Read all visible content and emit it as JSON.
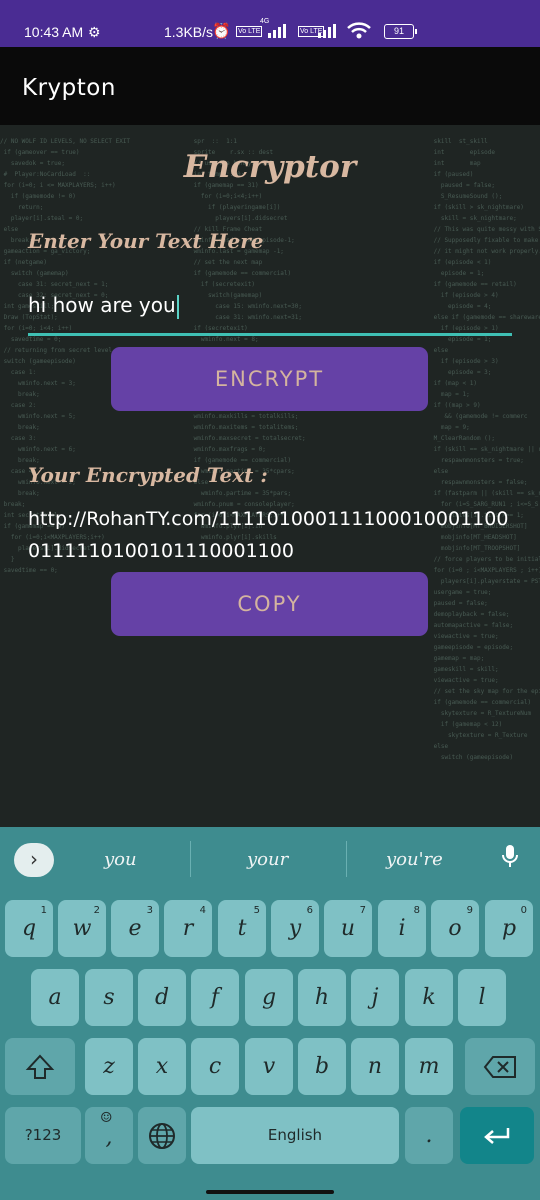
{
  "status_bar": {
    "time": "10:43 AM",
    "speed": "1.3KB/s",
    "battery": "91",
    "volte1": "Vo LTE",
    "volte2": "Vo LTE",
    "net": "4G"
  },
  "app_bar": {
    "title": "Krypton"
  },
  "main": {
    "heading": "Encryptor",
    "input_label": "Enter Your Text Here",
    "input_value": "hi how are you",
    "encrypt_button": "ENCRYPT",
    "result_label": "Your Encrypted Text :",
    "result_value": "http://RohanTY.com/1111010001111000100011000111110100101110001100",
    "copy_button": "COPY"
  },
  "keyboard": {
    "suggestions": [
      "you",
      "your",
      "you're"
    ],
    "row1": [
      {
        "label": "q",
        "num": "1"
      },
      {
        "label": "w",
        "num": "2"
      },
      {
        "label": "e",
        "num": "3"
      },
      {
        "label": "r",
        "num": "4"
      },
      {
        "label": "t",
        "num": "5"
      },
      {
        "label": "y",
        "num": "6"
      },
      {
        "label": "u",
        "num": "7"
      },
      {
        "label": "i",
        "num": "8"
      },
      {
        "label": "o",
        "num": "9"
      },
      {
        "label": "p",
        "num": "0"
      }
    ],
    "row2": [
      "a",
      "s",
      "d",
      "f",
      "g",
      "h",
      "j",
      "k",
      "l"
    ],
    "row3": [
      "z",
      "x",
      "c",
      "v",
      "b",
      "n",
      "m"
    ],
    "symbols_label": "?123",
    "space_label": "English",
    "comma_label": ",",
    "period_label": "."
  },
  "colors": {
    "status_bar": "#4a2c93",
    "accent_button": "#6541a6",
    "heading_text": "#d8b8a1",
    "keyboard_bg": "#3e8c8f",
    "key_bg": "#7fc1c5",
    "enter_key": "#12858a"
  },
  "icons": [
    "settings-gear-icon",
    "alarm-icon",
    "signal-icon",
    "wifi-icon",
    "battery-icon",
    "chevron-right-icon",
    "microphone-icon",
    "shift-icon",
    "backspace-icon",
    "emoji-icon",
    "globe-icon",
    "enter-icon"
  ]
}
